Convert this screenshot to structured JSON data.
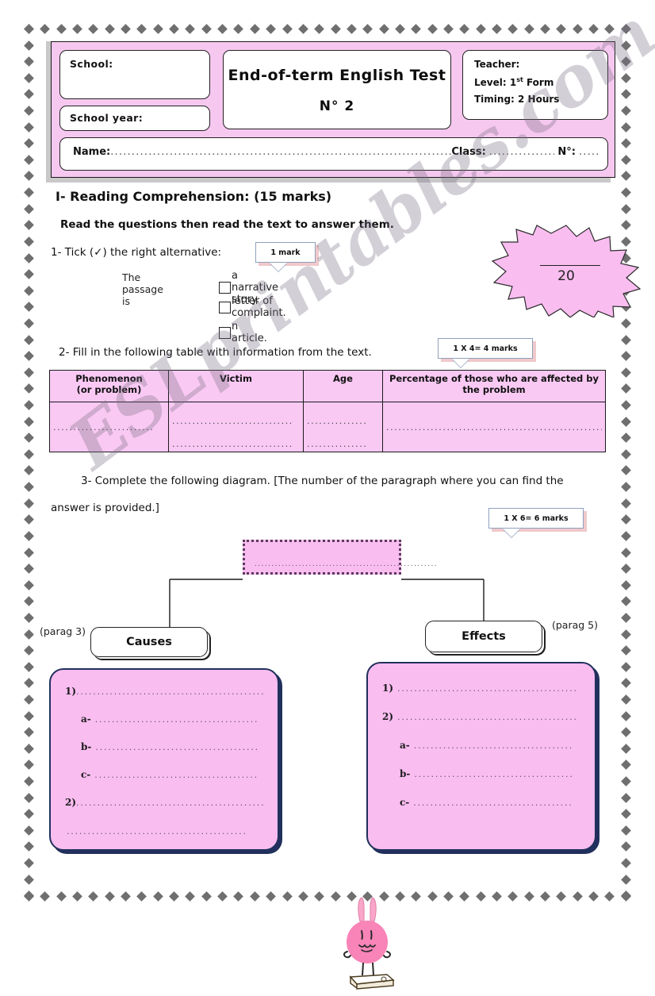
{
  "header": {
    "school_label": "School:",
    "school_year_label": "School year:",
    "title_main": "End-of-term English Test",
    "title_sub": "N°  2",
    "teacher_label": "Teacher:",
    "level_label": "Level: 1",
    "level_sup": "st",
    "level_rest": " Form",
    "timing_label": "Timing: 2 Hours",
    "name_label": "Name:",
    "name_dots": "...................................................................................................",
    "class_label": "Class:",
    "class_dots": "...................",
    "number_label": "N°:",
    "number_dots": "......"
  },
  "score_badge": {
    "value": "20",
    "name": "score-starburst"
  },
  "section": {
    "heading": "I- Reading Comprehension: (15 marks)",
    "instruction": "Read the questions then read the text to answer them."
  },
  "q1": {
    "prompt": "1- Tick (✓) the right alternative:",
    "mark_badge": "1 mark",
    "stem": "The passage is",
    "options": [
      "a narrative story.",
      "letter of complaint.",
      "n article."
    ]
  },
  "q2": {
    "prompt": "2- Fill in the following table with information from the text.",
    "mark_badge": "1 X 4= 4 marks",
    "table": {
      "headers": [
        "Phenomenon\n(or problem)",
        "Victim",
        "Age",
        "Percentage of those who are affected by the problem"
      ],
      "header_lines": [
        [
          "Phenomenon",
          "(or problem)"
        ],
        [
          "Victim"
        ],
        [
          "Age"
        ],
        [
          "Percentage of those who are affected by",
          "the problem"
        ]
      ],
      "row_dots": {
        "phenomenon": ".........................",
        "victim_1": "..............................",
        "victim_2": "..............................",
        "age_1": "...............",
        "age_2": "...............",
        "percentage": "..............................................................................."
      }
    }
  },
  "q3": {
    "prompt_line1": "3- Complete the following diagram. [The number of the paragraph where you can find the",
    "prompt_line2": "answer is provided.]",
    "mark_badge": "1 X 6= 6 marks",
    "diagram": {
      "top_box_dots": "......................................................",
      "causes_label": "Causes",
      "effects_label": "Effects",
      "causes_parag": "(parag 3)",
      "effects_parag": "(parag 5)",
      "left_box_lines": [
        {
          "marker": "1)",
          "dots": "............................................."
        },
        {
          "marker": "a-",
          "dots": "......................................."
        },
        {
          "marker": "b-",
          "dots": "......................................."
        },
        {
          "marker": "c-",
          "dots": "......................................."
        },
        {
          "marker": "2)",
          "dots": "............................................."
        },
        {
          "marker": "",
          "dots": "..........................................."
        }
      ],
      "right_box_lines": [
        {
          "marker": "1)",
          "dots": "..........................................."
        },
        {
          "marker": "2)",
          "dots": "..........................................."
        },
        {
          "marker": "a-",
          "dots": "......................................"
        },
        {
          "marker": "b-",
          "dots": "......................................"
        },
        {
          "marker": "c-",
          "dots": "......................................"
        }
      ]
    }
  },
  "mascot": {
    "name": "pink-bunny-on-book-mascot"
  },
  "watermark": {
    "text": "ESLprintables.com"
  },
  "colors": {
    "header_band_pink": "#f6c8f0",
    "table_pink": "#f9c9f4",
    "answer_box_pink": "#f9bdf0",
    "answer_box_border": "#21305c",
    "border_diamond_gray": "#6f6f6f",
    "callout_shadow_pink": "#f0c9cb"
  }
}
